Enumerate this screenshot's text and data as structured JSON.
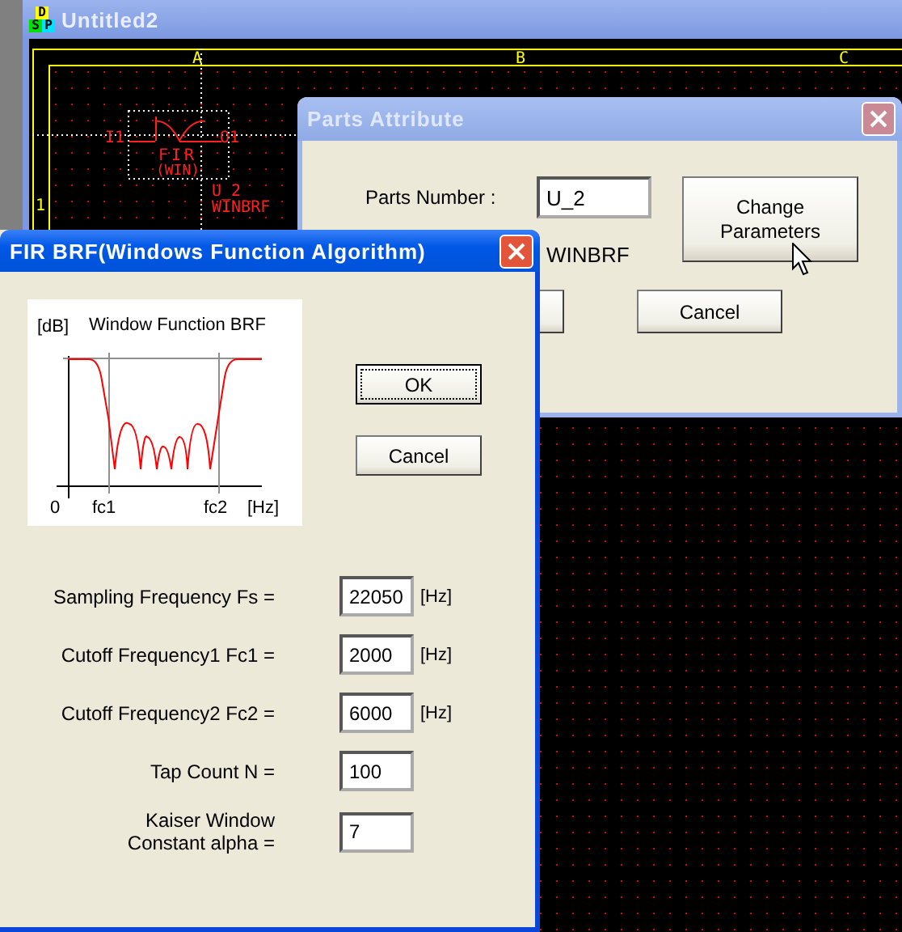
{
  "main_window": {
    "title": "Untitled2",
    "icon_letters": [
      "D",
      "S",
      "P"
    ],
    "active": false
  },
  "schematic": {
    "column_labels": [
      "A",
      "B",
      "C"
    ],
    "row_labels": [
      "1"
    ],
    "part": {
      "input_pin": "I1",
      "output_pin": "O1",
      "name": "FIR",
      "subtitle": "(WIN)",
      "reference": "U_2",
      "type": "WINBRF",
      "selected": true
    }
  },
  "parts_dialog": {
    "title": "Parts Attribute",
    "active": false,
    "parts_number_label": "Parts Number :",
    "parts_number": "U_2",
    "part_type": "WINBRF",
    "change_button": "Change Parameters",
    "cancel_button": "Cancel"
  },
  "fir_dialog": {
    "title": "FIR BRF(Windows Function Algorithm)",
    "active": true,
    "graph": {
      "title": "Window Function BRF",
      "y_unit": "[dB]",
      "origin": "0",
      "cutoff1": "fc1",
      "cutoff2": "fc2",
      "x_unit": "[Hz]"
    },
    "ok_button": "OK",
    "cancel_button": "Cancel",
    "fields": [
      {
        "label": "Sampling Frequency Fs =",
        "value": "22050",
        "unit": "[Hz]"
      },
      {
        "label": "Cutoff Frequency1 Fc1 =",
        "value": "2000",
        "unit": "[Hz]"
      },
      {
        "label": "Cutoff Frequency2 Fc2 =",
        "value": "6000",
        "unit": "[Hz]"
      },
      {
        "label": "Tap Count N =",
        "value": "100"
      },
      {
        "label": "Kaiser Window\nConstant alpha =",
        "value": "7"
      }
    ]
  }
}
